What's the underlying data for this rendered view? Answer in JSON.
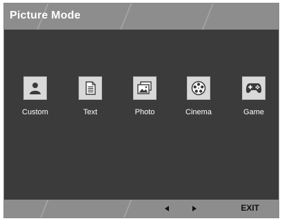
{
  "title": "Picture Mode",
  "modes": [
    {
      "label": "Custom",
      "icon": "person-icon"
    },
    {
      "label": "Text",
      "icon": "document-icon"
    },
    {
      "label": "Photo",
      "icon": "photo-icon"
    },
    {
      "label": "Cinema",
      "icon": "film-reel-icon"
    },
    {
      "label": "Game",
      "icon": "gamepad-icon"
    }
  ],
  "bottom": {
    "exit_label": "EXIT"
  },
  "colors": {
    "bar": "#8d8d8d",
    "background": "#3b3b3b",
    "icon_tile": "#d9d9d9"
  }
}
